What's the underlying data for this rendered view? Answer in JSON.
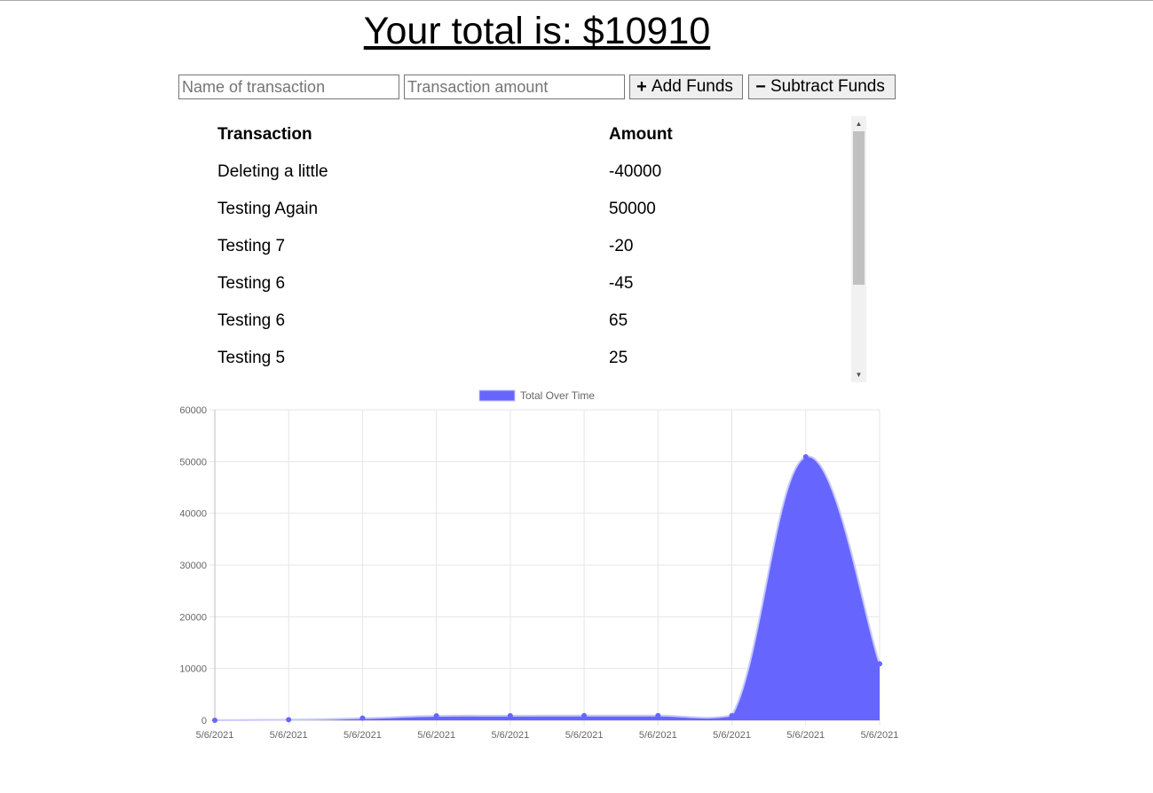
{
  "header": {
    "total_text": "Your total is: $10910"
  },
  "form": {
    "name_placeholder": "Name of transaction",
    "amount_placeholder": "Transaction amount",
    "add_label": "Add Funds",
    "subtract_label": "Subtract Funds",
    "add_icon": "plus-icon",
    "subtract_icon": "minus-icon"
  },
  "table": {
    "columns": [
      "Transaction",
      "Amount"
    ],
    "rows": [
      {
        "name": "Deleting a little",
        "amount": "-40000"
      },
      {
        "name": "Testing Again",
        "amount": "50000"
      },
      {
        "name": "Testing 7",
        "amount": "-20"
      },
      {
        "name": "Testing 6",
        "amount": "-45"
      },
      {
        "name": "Testing 6",
        "amount": "65"
      },
      {
        "name": "Testing 5",
        "amount": "25"
      }
    ]
  },
  "chart_data": {
    "type": "area",
    "legend": [
      "Total Over Time"
    ],
    "legend_position": "top",
    "x": [
      "5/6/2021",
      "5/6/2021",
      "5/6/2021",
      "5/6/2021",
      "5/6/2021",
      "5/6/2021",
      "5/6/2021",
      "5/6/2021",
      "5/6/2021",
      "5/6/2021"
    ],
    "series": [
      {
        "name": "Total Over Time",
        "values": [
          0,
          100,
          400,
          850,
          870,
          910,
          890,
          910,
          50910,
          10910
        ]
      }
    ],
    "yticks": [
      "0",
      "10000",
      "20000",
      "30000",
      "40000",
      "50000",
      "60000"
    ],
    "ylim": [
      0,
      60000
    ],
    "grid": true,
    "colors": {
      "fill": "#6666ff",
      "line": "#c8c8ff",
      "point": "#6666ff",
      "grid": "#e6e6e6",
      "tick_text": "#666666"
    }
  }
}
